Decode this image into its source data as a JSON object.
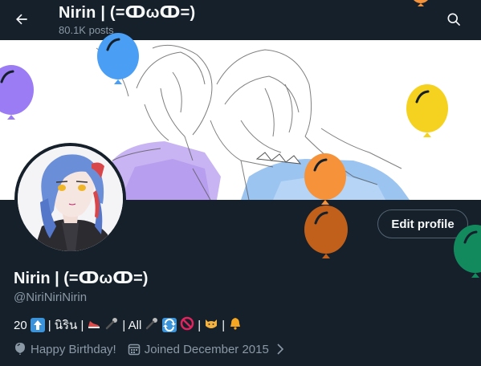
{
  "header": {
    "title": "Nirin | (=ↀωↀ=)",
    "posts": "80.1K posts"
  },
  "profile": {
    "name": "Nirin | (=ↀωↀ=)",
    "handle": "@NiriNiriNirin",
    "edit_label": "Edit profile",
    "bio": {
      "t1": "20",
      "t2": "| นิริน |",
      "t3": "| All",
      "t4": "|",
      "t5": "|",
      "t6": "|"
    },
    "birthday": "Happy Birthday!",
    "joined": "Joined December 2015"
  },
  "colors": {
    "background": "#15202b",
    "muted_text": "#8b98a5",
    "balloon_blue": "#4a9ff5",
    "balloon_purple": "#9b7cf5",
    "balloon_yellow": "#f5d21f",
    "balloon_orange": "#f5923a",
    "balloon_darkorange": "#c1601a",
    "balloon_green": "#138a5e"
  },
  "icons": [
    "back-arrow-icon",
    "search-icon",
    "balloon-icon",
    "calendar-icon",
    "chevron-right-icon"
  ]
}
